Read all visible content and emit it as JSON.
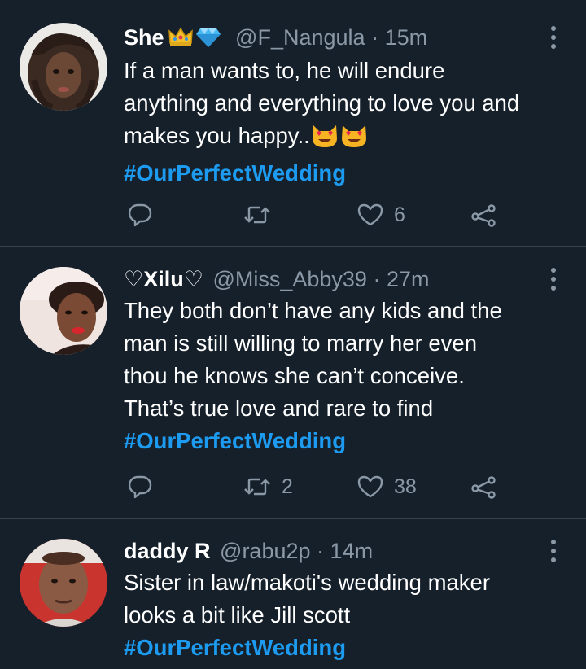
{
  "tweets": [
    {
      "name": "She",
      "badges": [
        "crown-emoji",
        "gem-emoji"
      ],
      "handle": "@F_Nangula",
      "dot": "·",
      "time": "15m",
      "lines": [
        "If a man wants to, he will endure",
        "anything and everything to love you and",
        "makes you happy.."
      ],
      "line3_emoji": [
        "smiling-cat-heart-eyes-emoji",
        "smiling-cat-heart-eyes-emoji"
      ],
      "hashtag": "#OurPerfectWedding",
      "reply_count": "",
      "retweet_count": "",
      "like_count": "6"
    },
    {
      "name": "♡Xilu♡",
      "badges": [],
      "handle": "@Miss_Abby39",
      "dot": "·",
      "time": "27m",
      "lines": [
        "They both don’t have any kids and the",
        "man is still willing to marry her even",
        "thou he knows she can’t conceive.",
        "That’s true love and rare to find"
      ],
      "hashtag": "#OurPerfectWedding",
      "reply_count": "",
      "retweet_count": "2",
      "like_count": "38"
    },
    {
      "name": "daddy R",
      "badges": [],
      "handle": "@rabu2p",
      "dot": "·",
      "time": "14m",
      "lines": [
        "Sister in law/makoti's wedding maker",
        "looks a bit like Jill scott"
      ],
      "hashtag": "#OurPerfectWedding"
    }
  ],
  "icons": {
    "reply": "reply-icon",
    "retweet": "retweet-icon",
    "like": "heart-icon",
    "share": "share-icon",
    "more": "more-options-icon"
  },
  "colors": {
    "background": "#15202b",
    "divider": "#38444d",
    "secondary_text": "#8b98a5",
    "hashtag": "#1d9bf0"
  }
}
